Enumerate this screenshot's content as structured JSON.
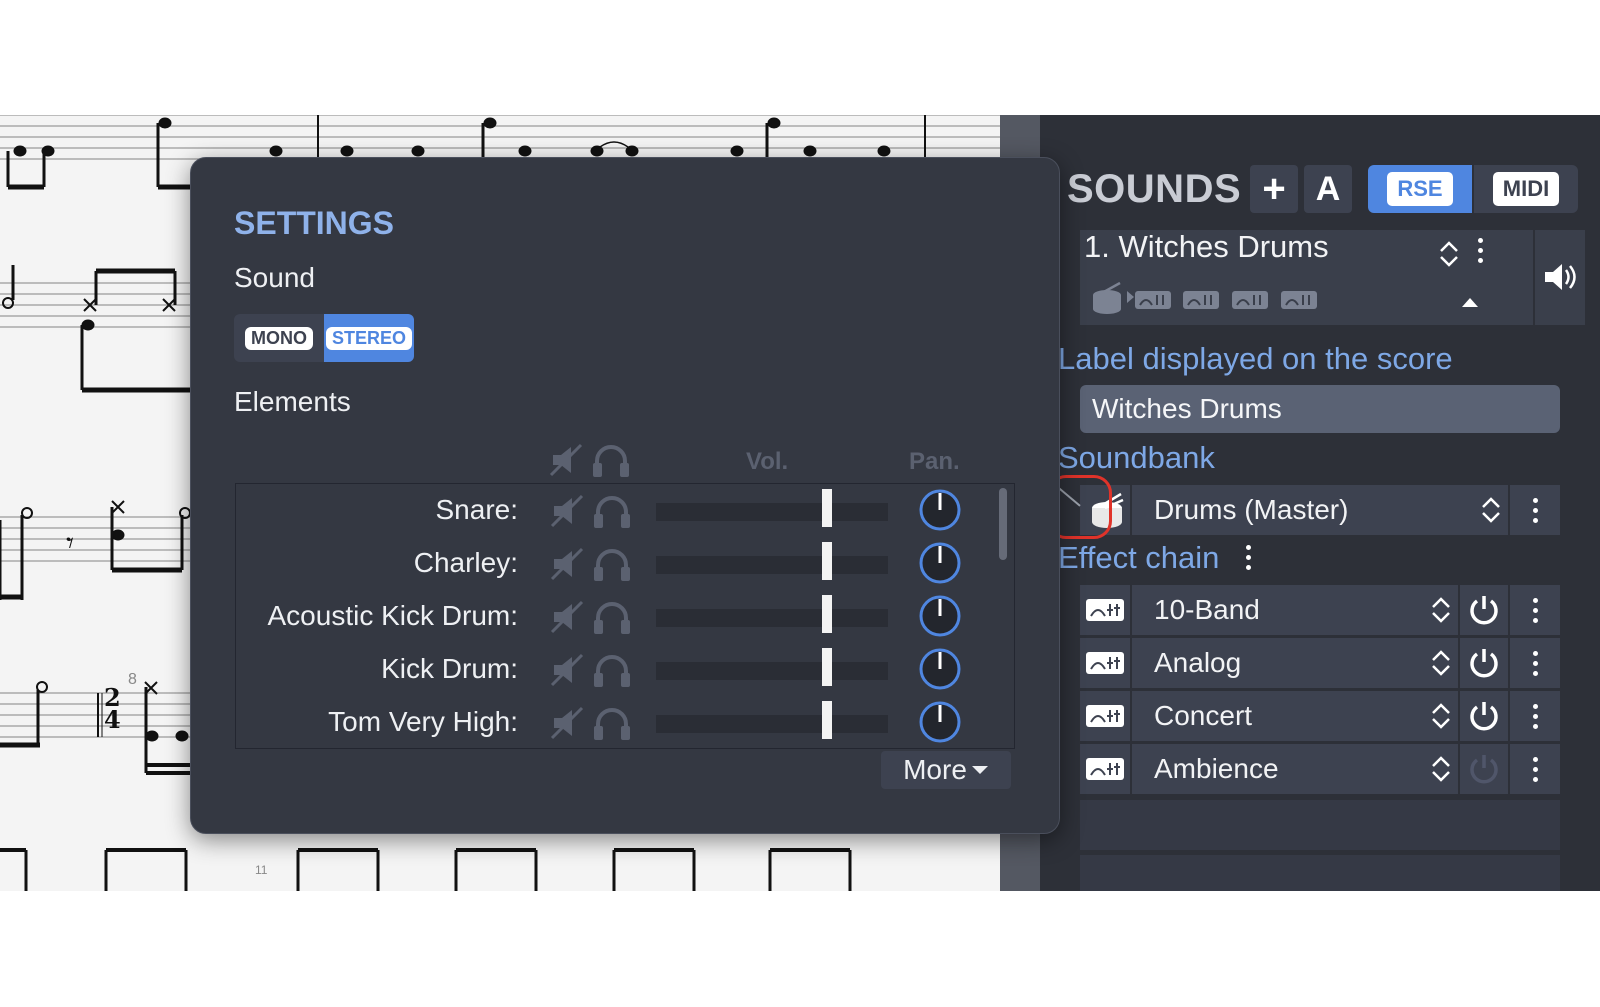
{
  "sounds_panel": {
    "title": "SOUNDS",
    "add_label": "+",
    "auto_label": "A",
    "rse_label": "RSE",
    "midi_label": "MIDI",
    "track_name": "1. Witches Drums",
    "label_section": "Label displayed on the score",
    "label_value": "Witches Drums",
    "soundbank_section": "Soundbank",
    "soundbank_value": "Drums (Master)",
    "effect_chain_section": "Effect chain",
    "effects": [
      {
        "name": "10-Band",
        "enabled": true
      },
      {
        "name": "Analog",
        "enabled": true
      },
      {
        "name": "Concert",
        "enabled": true
      },
      {
        "name": "Ambience",
        "enabled": false
      }
    ],
    "colors": {
      "accent": "#4f86e0",
      "label": "#7ea8e6",
      "highlight_ring": "#e0332a"
    }
  },
  "settings": {
    "title": "SETTINGS",
    "sound_label": "Sound",
    "mono_label": "MONO",
    "stereo_label": "STEREO",
    "elements_label": "Elements",
    "vol_header": "Vol.",
    "pan_header": "Pan.",
    "more_label": "More",
    "elements": [
      {
        "name": "Snare:",
        "volume": 0.8,
        "pan": 0.5
      },
      {
        "name": "Charley:",
        "volume": 0.8,
        "pan": 0.5
      },
      {
        "name": "Acoustic Kick Drum:",
        "volume": 0.8,
        "pan": 0.5
      },
      {
        "name": "Kick Drum:",
        "volume": 0.8,
        "pan": 0.5
      },
      {
        "name": "Tom Very High:",
        "volume": 0.8,
        "pan": 0.5
      }
    ]
  },
  "score": {
    "measure_number": "8",
    "time_signature_top": "2",
    "time_signature_bottom": "4",
    "bottom_measure_number": "11"
  }
}
